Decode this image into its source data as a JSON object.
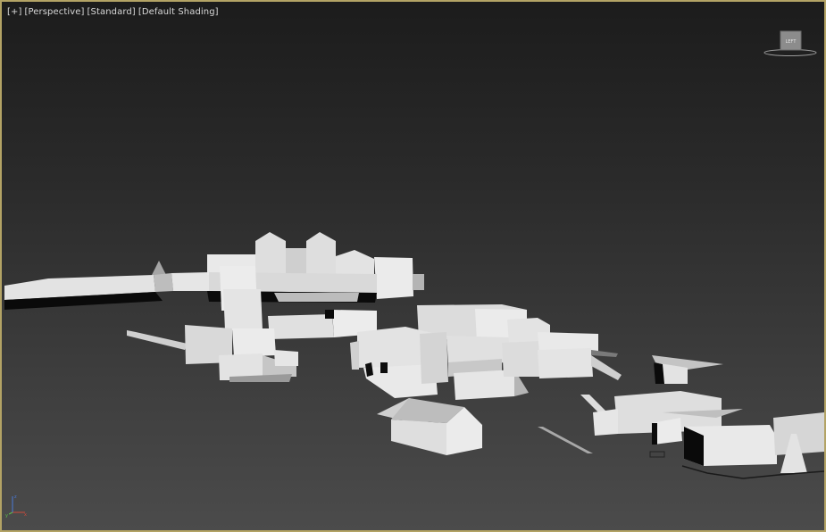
{
  "viewport": {
    "labels": [
      "[+]",
      "[Perspective]",
      "[Standard]",
      "[Default Shading]"
    ],
    "border_color": "#b3a365"
  },
  "viewcube": {
    "face_label": "LEFT",
    "icon": "viewcube-icon"
  },
  "axis_tripod": {
    "x_label": "x",
    "y_label": "y",
    "z_label": "z",
    "colors": {
      "x": "#d04a3a",
      "y": "#5fbf4a",
      "z": "#4a7ad8"
    }
  },
  "scene": {
    "description_icon": "3d-town-model"
  }
}
